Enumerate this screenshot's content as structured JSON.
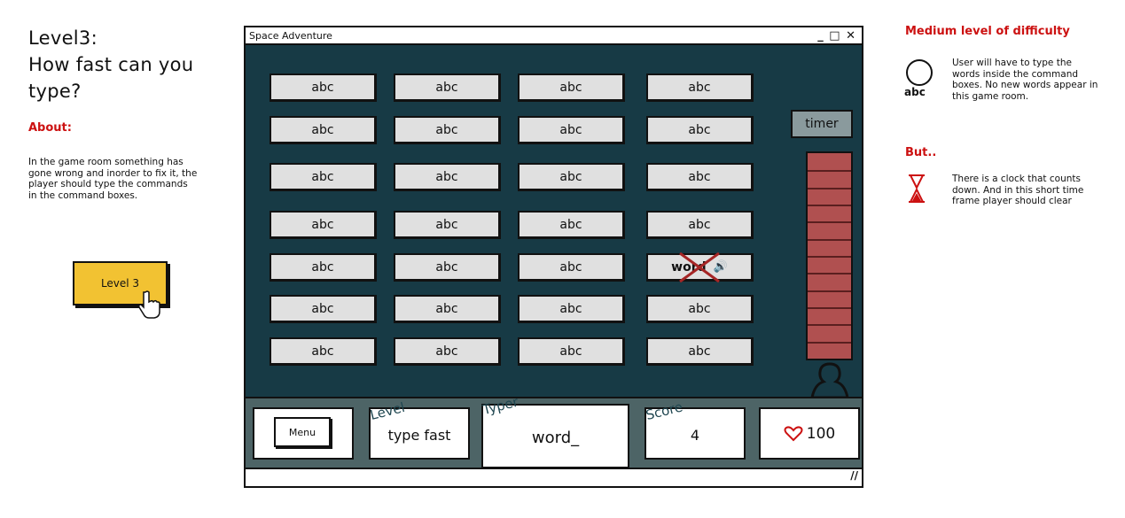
{
  "left_panel": {
    "title_line1": "Level3:",
    "title_line2": "How fast can you",
    "title_line3": "type?",
    "about_heading": "About:",
    "about_text": "In the game room something has gone wrong and inorder to fix it, the player should type the commands in the command boxes.",
    "level_button_label": "Level 3"
  },
  "window": {
    "title": "Space Adventure",
    "controls": "_ □ ✕",
    "word_grid": [
      [
        "abc",
        "abc",
        "abc",
        "abc"
      ],
      [
        "abc",
        "abc",
        "abc",
        "abc"
      ],
      [
        "abc",
        "abc",
        "abc",
        "abc"
      ],
      [
        "abc",
        "abc",
        "abc",
        "abc"
      ],
      [
        "abc",
        "abc",
        "abc",
        "word"
      ],
      [
        "abc",
        "abc",
        "abc",
        "abc"
      ],
      [
        "abc",
        "abc",
        "abc",
        "abc"
      ]
    ],
    "timer_label": "timer",
    "timer_segments": 12,
    "bottom": {
      "menu_label": "Menu",
      "level_caption": "Level",
      "level_value": "type fast",
      "typer_caption": "Typer",
      "typer_value": "word_",
      "score_caption": "Score",
      "score_value": "4",
      "health_value": "100"
    }
  },
  "right_panel": {
    "difficulty_heading": "Medium level of difficulty",
    "icon_caption": "abc",
    "difficulty_text": "User will have to type the words inside the command boxes. No new words appear in this game room.",
    "but_heading": "But..",
    "but_text": "There is a clock that counts down. And in this short time frame player should clear"
  },
  "colors": {
    "accent_red": "#cc1111",
    "game_bg": "#173a45",
    "level_button": "#f2c232",
    "timer_bar": "#b05050"
  }
}
